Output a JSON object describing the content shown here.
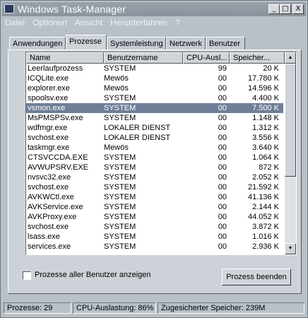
{
  "window": {
    "title": "Windows Task-Manager"
  },
  "titlebar_buttons": {
    "minimize": "_",
    "maximize": "□",
    "close": "X"
  },
  "menu": [
    "Datei",
    "Optionen",
    "Ansicht",
    "Herunterfahren",
    "?"
  ],
  "tabs": [
    "Anwendungen",
    "Prozesse",
    "Systemleistung",
    "Netzwerk",
    "Benutzer"
  ],
  "active_tab": "Prozesse",
  "columns": [
    "Name",
    "Benutzername",
    "CPU-Ausl...",
    "Speicher..."
  ],
  "processes": [
    {
      "name": "Leerlaufprozess",
      "user": "SYSTEM",
      "cpu": "99",
      "mem": "20 K"
    },
    {
      "name": "ICQLite.exe",
      "user": "Mewös",
      "cpu": "00",
      "mem": "17.780 K"
    },
    {
      "name": "explorer.exe",
      "user": "Mewös",
      "cpu": "00",
      "mem": "14.596 K"
    },
    {
      "name": "spoolsv.exe",
      "user": "SYSTEM",
      "cpu": "00",
      "mem": "4.400 K"
    },
    {
      "name": "vsmon.exe",
      "user": "SYSTEM",
      "cpu": "00",
      "mem": "7.500 K"
    },
    {
      "name": "MsPMSPSv.exe",
      "user": "SYSTEM",
      "cpu": "00",
      "mem": "1.148 K"
    },
    {
      "name": "wdfmgr.exe",
      "user": "LOKALER DIENST",
      "cpu": "00",
      "mem": "1.312 K"
    },
    {
      "name": "svchost.exe",
      "user": "LOKALER DIENST",
      "cpu": "00",
      "mem": "3.556 K"
    },
    {
      "name": "taskmgr.exe",
      "user": "Mewös",
      "cpu": "00",
      "mem": "3.640 K"
    },
    {
      "name": "CTSVCCDA.EXE",
      "user": "SYSTEM",
      "cpu": "00",
      "mem": "1.064 K"
    },
    {
      "name": "AVWUPSRV.EXE",
      "user": "SYSTEM",
      "cpu": "00",
      "mem": "872 K"
    },
    {
      "name": "nvsvc32.exe",
      "user": "SYSTEM",
      "cpu": "00",
      "mem": "2.052 K"
    },
    {
      "name": "svchost.exe",
      "user": "SYSTEM",
      "cpu": "00",
      "mem": "21.592 K"
    },
    {
      "name": "AVKWCtl.exe",
      "user": "SYSTEM",
      "cpu": "00",
      "mem": "41.136 K"
    },
    {
      "name": "AVKService.exe",
      "user": "SYSTEM",
      "cpu": "00",
      "mem": "2.144 K"
    },
    {
      "name": "AVKProxy.exe",
      "user": "SYSTEM",
      "cpu": "00",
      "mem": "44.052 K"
    },
    {
      "name": "svchost.exe",
      "user": "SYSTEM",
      "cpu": "00",
      "mem": "3.872 K"
    },
    {
      "name": "lsass.exe",
      "user": "SYSTEM",
      "cpu": "00",
      "mem": "1.016 K"
    },
    {
      "name": "services.exe",
      "user": "SYSTEM",
      "cpu": "00",
      "mem": "2.936 K"
    }
  ],
  "selected_process": "vsmon.exe",
  "show_all_users_label": "Prozesse aller Benutzer anzeigen",
  "end_process_label": "Prozess beenden",
  "status": {
    "processes": "Prozesse: 29",
    "cpu": "CPU-Auslastung: 86%",
    "commit": "Zugesicherter Speicher: 239M"
  }
}
